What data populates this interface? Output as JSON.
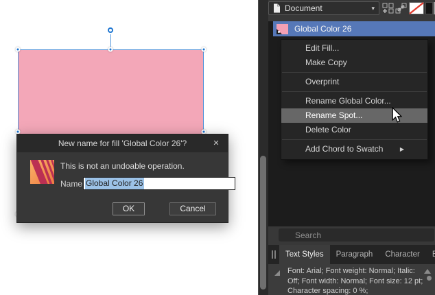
{
  "icons": {
    "dropdown_arrow": "▾",
    "close": "✕",
    "submenu_arrow": "▶"
  },
  "colors": {
    "shape_pink": "#f3a7b8",
    "selection_blue": "#4f93da",
    "handle_blue": "#1b74d1",
    "row_highlight_blue": "#5678b8",
    "menu_highlight_gray": "#676767",
    "panel_bg": "#383838",
    "list_bg": "#1c1c1c",
    "no_fill_red": "#e23b2e"
  },
  "dialog": {
    "title": "New name for fill 'Global Color 26'?",
    "message": "This is not an undoable operation.",
    "name_label": "Name:",
    "name_value": "Global Color 26",
    "ok_label": "OK",
    "cancel_label": "Cancel"
  },
  "panel": {
    "document_select": "Document",
    "swatch_item_label": "Global Color 26",
    "search_placeholder": "Search",
    "tabs": [
      {
        "label": "Text Styles",
        "active": true
      },
      {
        "label": "Paragraph",
        "active": false
      },
      {
        "label": "Character",
        "active": false
      },
      {
        "label": "Effects",
        "active": false
      }
    ],
    "style_description": "Font: Arial; Font weight: Normal; Italic: Off; Font width: Normal; Font size: 12 pt; Character spacing: 0 %;"
  },
  "menu": {
    "items": [
      {
        "label": "Edit Fill..."
      },
      {
        "label": "Make Copy"
      },
      {
        "label": "Overprint"
      },
      {
        "label": "Rename Global Color..."
      },
      {
        "label": "Rename Spot...",
        "highlighted": true
      },
      {
        "label": "Delete Color"
      },
      {
        "label": "Add Chord to Swatch",
        "has_submenu": true
      }
    ]
  }
}
